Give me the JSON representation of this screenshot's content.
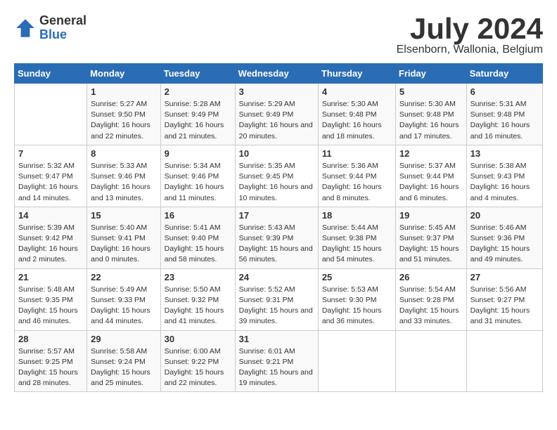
{
  "logo": {
    "general": "General",
    "blue": "Blue"
  },
  "title": {
    "month": "July 2024",
    "location": "Elsenborn, Wallonia, Belgium"
  },
  "weekdays": [
    "Sunday",
    "Monday",
    "Tuesday",
    "Wednesday",
    "Thursday",
    "Friday",
    "Saturday"
  ],
  "rows": [
    [
      {
        "day": "",
        "sunrise": "",
        "sunset": "",
        "daylight": ""
      },
      {
        "day": "1",
        "sunrise": "Sunrise: 5:27 AM",
        "sunset": "Sunset: 9:50 PM",
        "daylight": "Daylight: 16 hours and 22 minutes."
      },
      {
        "day": "2",
        "sunrise": "Sunrise: 5:28 AM",
        "sunset": "Sunset: 9:49 PM",
        "daylight": "Daylight: 16 hours and 21 minutes."
      },
      {
        "day": "3",
        "sunrise": "Sunrise: 5:29 AM",
        "sunset": "Sunset: 9:49 PM",
        "daylight": "Daylight: 16 hours and 20 minutes."
      },
      {
        "day": "4",
        "sunrise": "Sunrise: 5:30 AM",
        "sunset": "Sunset: 9:48 PM",
        "daylight": "Daylight: 16 hours and 18 minutes."
      },
      {
        "day": "5",
        "sunrise": "Sunrise: 5:30 AM",
        "sunset": "Sunset: 9:48 PM",
        "daylight": "Daylight: 16 hours and 17 minutes."
      },
      {
        "day": "6",
        "sunrise": "Sunrise: 5:31 AM",
        "sunset": "Sunset: 9:48 PM",
        "daylight": "Daylight: 16 hours and 16 minutes."
      }
    ],
    [
      {
        "day": "7",
        "sunrise": "Sunrise: 5:32 AM",
        "sunset": "Sunset: 9:47 PM",
        "daylight": "Daylight: 16 hours and 14 minutes."
      },
      {
        "day": "8",
        "sunrise": "Sunrise: 5:33 AM",
        "sunset": "Sunset: 9:46 PM",
        "daylight": "Daylight: 16 hours and 13 minutes."
      },
      {
        "day": "9",
        "sunrise": "Sunrise: 5:34 AM",
        "sunset": "Sunset: 9:46 PM",
        "daylight": "Daylight: 16 hours and 11 minutes."
      },
      {
        "day": "10",
        "sunrise": "Sunrise: 5:35 AM",
        "sunset": "Sunset: 9:45 PM",
        "daylight": "Daylight: 16 hours and 10 minutes."
      },
      {
        "day": "11",
        "sunrise": "Sunrise: 5:36 AM",
        "sunset": "Sunset: 9:44 PM",
        "daylight": "Daylight: 16 hours and 8 minutes."
      },
      {
        "day": "12",
        "sunrise": "Sunrise: 5:37 AM",
        "sunset": "Sunset: 9:44 PM",
        "daylight": "Daylight: 16 hours and 6 minutes."
      },
      {
        "day": "13",
        "sunrise": "Sunrise: 5:38 AM",
        "sunset": "Sunset: 9:43 PM",
        "daylight": "Daylight: 16 hours and 4 minutes."
      }
    ],
    [
      {
        "day": "14",
        "sunrise": "Sunrise: 5:39 AM",
        "sunset": "Sunset: 9:42 PM",
        "daylight": "Daylight: 16 hours and 2 minutes."
      },
      {
        "day": "15",
        "sunrise": "Sunrise: 5:40 AM",
        "sunset": "Sunset: 9:41 PM",
        "daylight": "Daylight: 16 hours and 0 minutes."
      },
      {
        "day": "16",
        "sunrise": "Sunrise: 5:41 AM",
        "sunset": "Sunset: 9:40 PM",
        "daylight": "Daylight: 15 hours and 58 minutes."
      },
      {
        "day": "17",
        "sunrise": "Sunrise: 5:43 AM",
        "sunset": "Sunset: 9:39 PM",
        "daylight": "Daylight: 15 hours and 56 minutes."
      },
      {
        "day": "18",
        "sunrise": "Sunrise: 5:44 AM",
        "sunset": "Sunset: 9:38 PM",
        "daylight": "Daylight: 15 hours and 54 minutes."
      },
      {
        "day": "19",
        "sunrise": "Sunrise: 5:45 AM",
        "sunset": "Sunset: 9:37 PM",
        "daylight": "Daylight: 15 hours and 51 minutes."
      },
      {
        "day": "20",
        "sunrise": "Sunrise: 5:46 AM",
        "sunset": "Sunset: 9:36 PM",
        "daylight": "Daylight: 15 hours and 49 minutes."
      }
    ],
    [
      {
        "day": "21",
        "sunrise": "Sunrise: 5:48 AM",
        "sunset": "Sunset: 9:35 PM",
        "daylight": "Daylight: 15 hours and 46 minutes."
      },
      {
        "day": "22",
        "sunrise": "Sunrise: 5:49 AM",
        "sunset": "Sunset: 9:33 PM",
        "daylight": "Daylight: 15 hours and 44 minutes."
      },
      {
        "day": "23",
        "sunrise": "Sunrise: 5:50 AM",
        "sunset": "Sunset: 9:32 PM",
        "daylight": "Daylight: 15 hours and 41 minutes."
      },
      {
        "day": "24",
        "sunrise": "Sunrise: 5:52 AM",
        "sunset": "Sunset: 9:31 PM",
        "daylight": "Daylight: 15 hours and 39 minutes."
      },
      {
        "day": "25",
        "sunrise": "Sunrise: 5:53 AM",
        "sunset": "Sunset: 9:30 PM",
        "daylight": "Daylight: 15 hours and 36 minutes."
      },
      {
        "day": "26",
        "sunrise": "Sunrise: 5:54 AM",
        "sunset": "Sunset: 9:28 PM",
        "daylight": "Daylight: 15 hours and 33 minutes."
      },
      {
        "day": "27",
        "sunrise": "Sunrise: 5:56 AM",
        "sunset": "Sunset: 9:27 PM",
        "daylight": "Daylight: 15 hours and 31 minutes."
      }
    ],
    [
      {
        "day": "28",
        "sunrise": "Sunrise: 5:57 AM",
        "sunset": "Sunset: 9:25 PM",
        "daylight": "Daylight: 15 hours and 28 minutes."
      },
      {
        "day": "29",
        "sunrise": "Sunrise: 5:58 AM",
        "sunset": "Sunset: 9:24 PM",
        "daylight": "Daylight: 15 hours and 25 minutes."
      },
      {
        "day": "30",
        "sunrise": "Sunrise: 6:00 AM",
        "sunset": "Sunset: 9:22 PM",
        "daylight": "Daylight: 15 hours and 22 minutes."
      },
      {
        "day": "31",
        "sunrise": "Sunrise: 6:01 AM",
        "sunset": "Sunset: 9:21 PM",
        "daylight": "Daylight: 15 hours and 19 minutes."
      },
      {
        "day": "",
        "sunrise": "",
        "sunset": "",
        "daylight": ""
      },
      {
        "day": "",
        "sunrise": "",
        "sunset": "",
        "daylight": ""
      },
      {
        "day": "",
        "sunrise": "",
        "sunset": "",
        "daylight": ""
      }
    ]
  ]
}
